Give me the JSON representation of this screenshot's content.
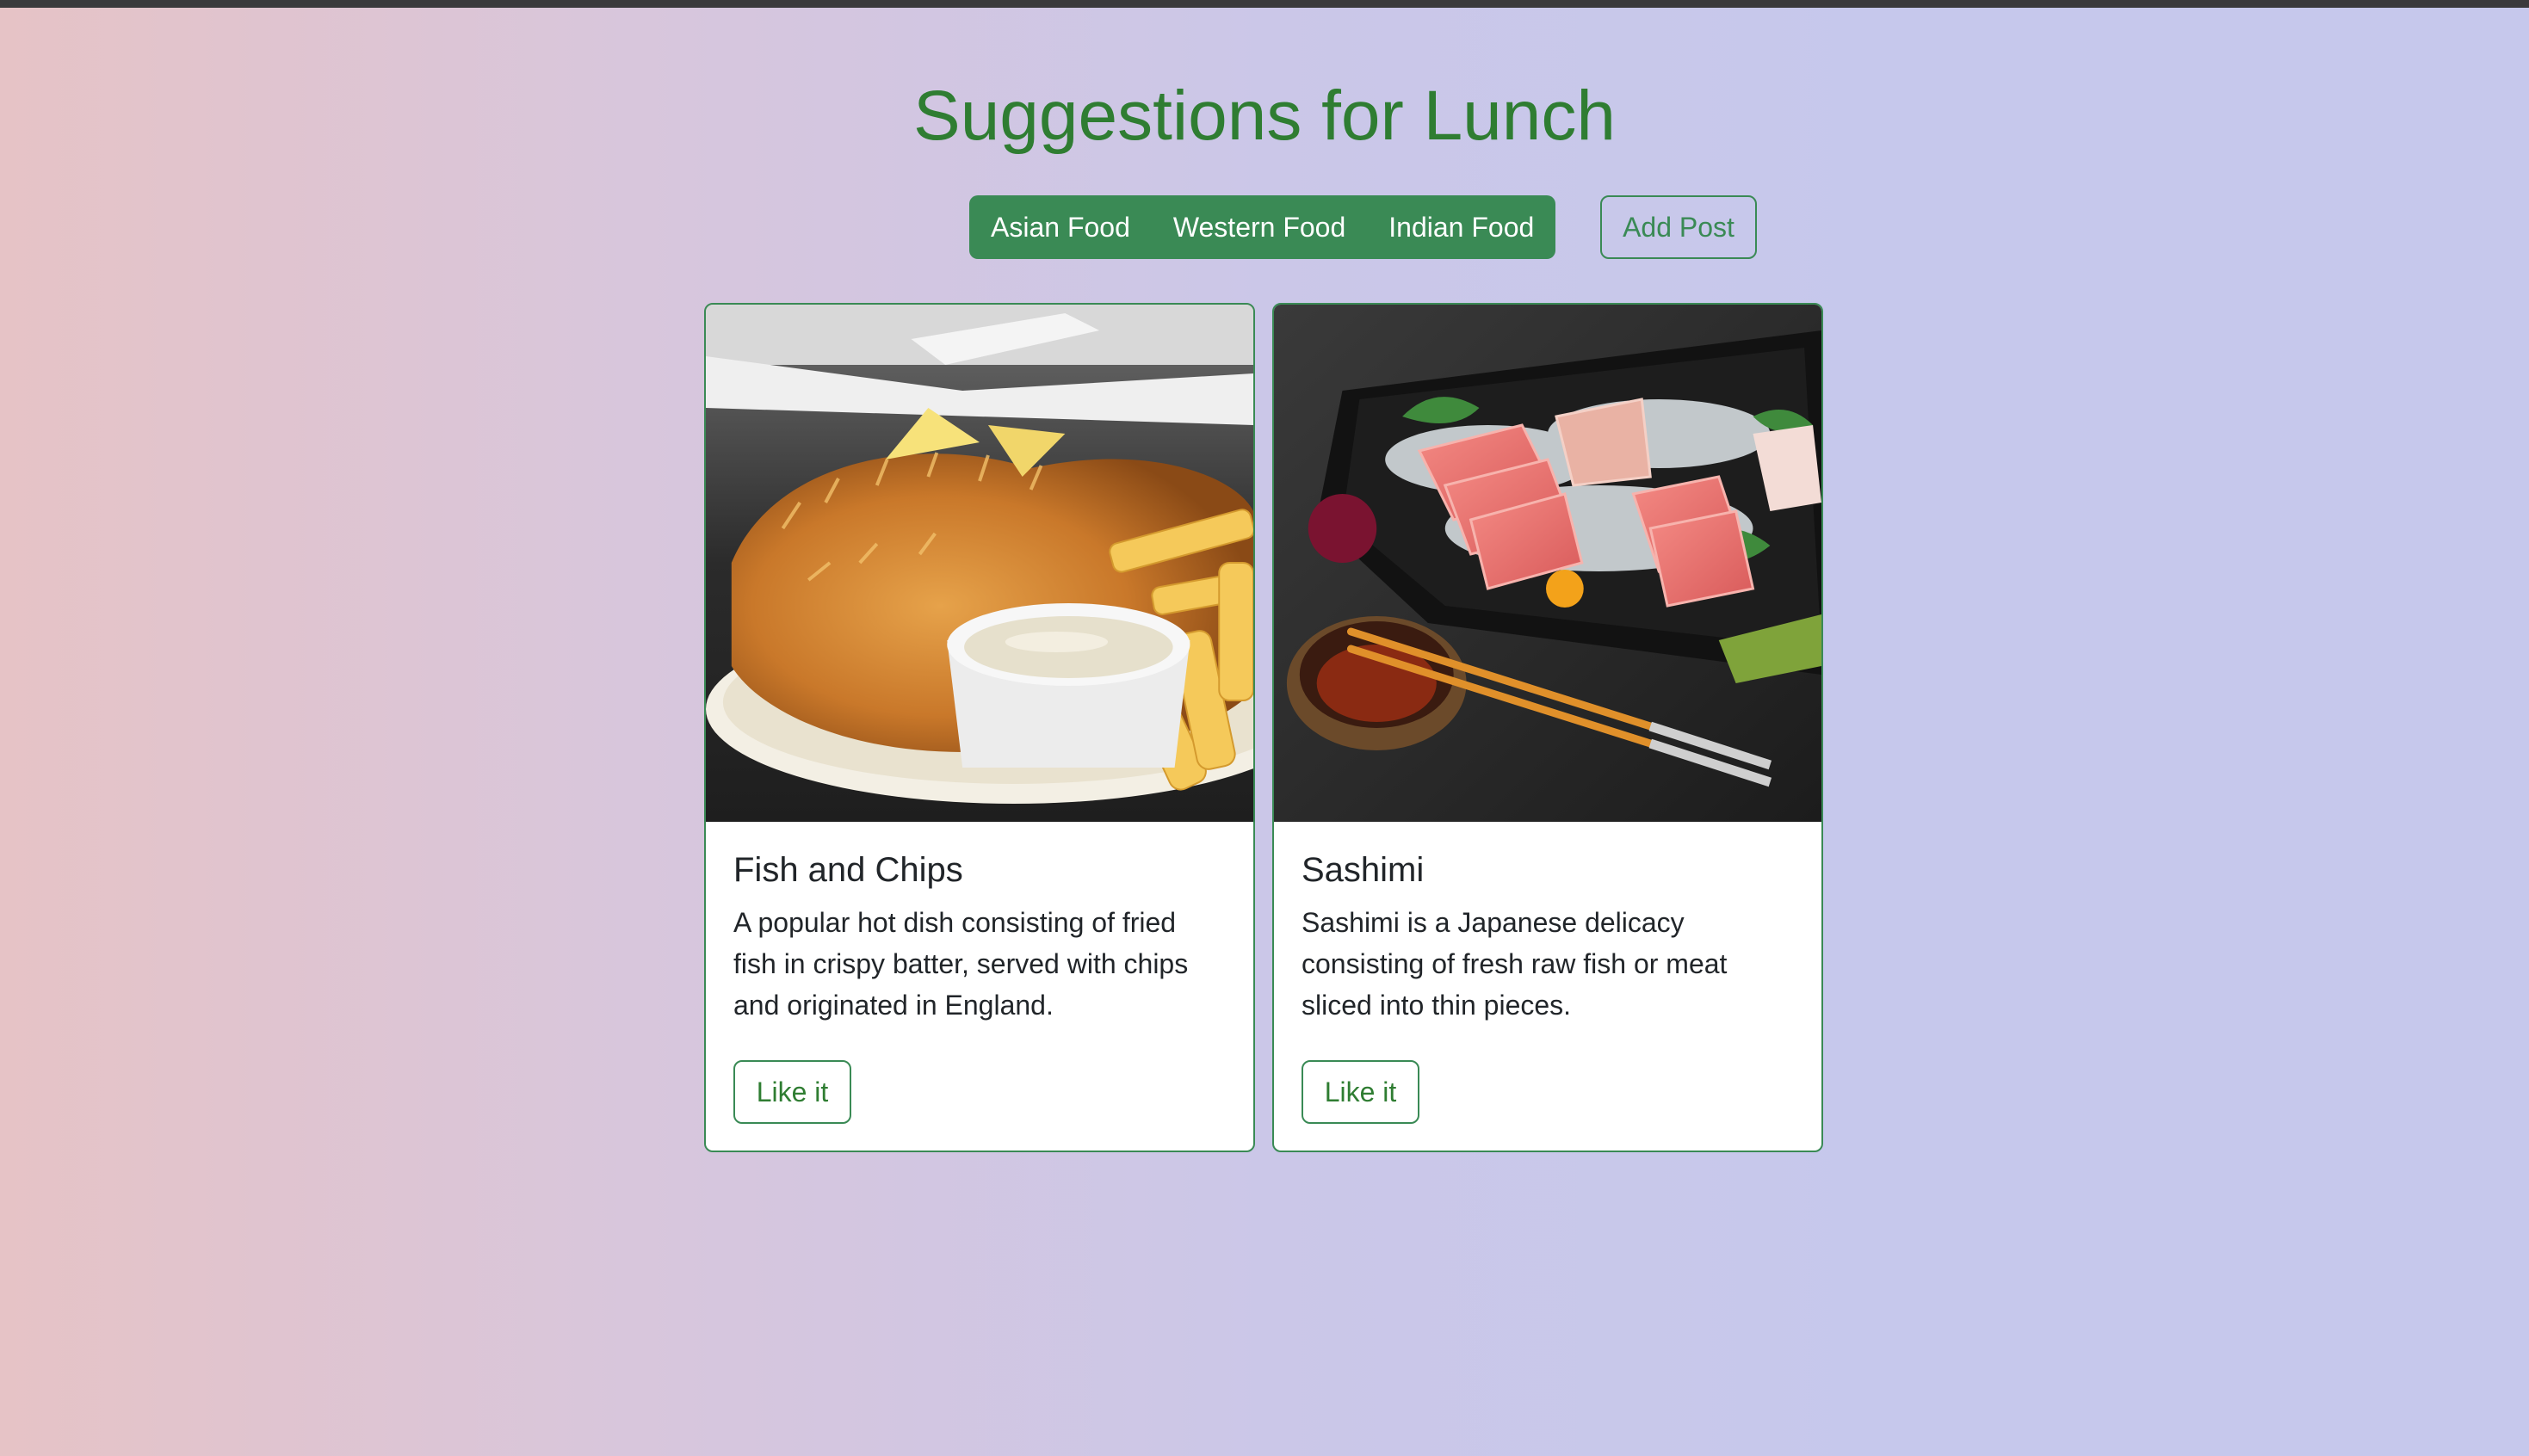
{
  "page": {
    "title": "Suggestions for Lunch"
  },
  "filters": {
    "items": [
      {
        "label": "Asian Food"
      },
      {
        "label": "Western Food"
      },
      {
        "label": "Indian Food"
      }
    ]
  },
  "actions": {
    "add_post_label": "Add Post"
  },
  "cards": [
    {
      "title": "Fish and Chips",
      "text": "A popular hot dish consisting of fried fish in crispy batter, served with chips and originated in England.",
      "like_label": "Like it",
      "image_icon": "fish-and-chips-photo"
    },
    {
      "title": "Sashimi",
      "text": "Sashimi is a Japanese delicacy consisting of fresh raw fish or meat sliced into thin pieces.",
      "like_label": "Like it",
      "image_icon": "sashimi-photo"
    }
  ],
  "colors": {
    "accent": "#3a8a55",
    "title": "#2f7d32",
    "topbar": "#3a3a3c"
  }
}
